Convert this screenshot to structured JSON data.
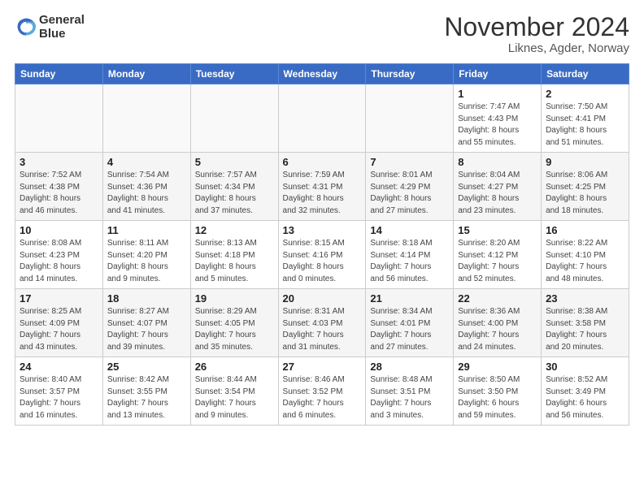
{
  "header": {
    "logo_line1": "General",
    "logo_line2": "Blue",
    "month": "November 2024",
    "location": "Liknes, Agder, Norway"
  },
  "weekdays": [
    "Sunday",
    "Monday",
    "Tuesday",
    "Wednesday",
    "Thursday",
    "Friday",
    "Saturday"
  ],
  "weeks": [
    [
      {
        "day": "",
        "info": ""
      },
      {
        "day": "",
        "info": ""
      },
      {
        "day": "",
        "info": ""
      },
      {
        "day": "",
        "info": ""
      },
      {
        "day": "",
        "info": ""
      },
      {
        "day": "1",
        "info": "Sunrise: 7:47 AM\nSunset: 4:43 PM\nDaylight: 8 hours\nand 55 minutes."
      },
      {
        "day": "2",
        "info": "Sunrise: 7:50 AM\nSunset: 4:41 PM\nDaylight: 8 hours\nand 51 minutes."
      }
    ],
    [
      {
        "day": "3",
        "info": "Sunrise: 7:52 AM\nSunset: 4:38 PM\nDaylight: 8 hours\nand 46 minutes."
      },
      {
        "day": "4",
        "info": "Sunrise: 7:54 AM\nSunset: 4:36 PM\nDaylight: 8 hours\nand 41 minutes."
      },
      {
        "day": "5",
        "info": "Sunrise: 7:57 AM\nSunset: 4:34 PM\nDaylight: 8 hours\nand 37 minutes."
      },
      {
        "day": "6",
        "info": "Sunrise: 7:59 AM\nSunset: 4:31 PM\nDaylight: 8 hours\nand 32 minutes."
      },
      {
        "day": "7",
        "info": "Sunrise: 8:01 AM\nSunset: 4:29 PM\nDaylight: 8 hours\nand 27 minutes."
      },
      {
        "day": "8",
        "info": "Sunrise: 8:04 AM\nSunset: 4:27 PM\nDaylight: 8 hours\nand 23 minutes."
      },
      {
        "day": "9",
        "info": "Sunrise: 8:06 AM\nSunset: 4:25 PM\nDaylight: 8 hours\nand 18 minutes."
      }
    ],
    [
      {
        "day": "10",
        "info": "Sunrise: 8:08 AM\nSunset: 4:23 PM\nDaylight: 8 hours\nand 14 minutes."
      },
      {
        "day": "11",
        "info": "Sunrise: 8:11 AM\nSunset: 4:20 PM\nDaylight: 8 hours\nand 9 minutes."
      },
      {
        "day": "12",
        "info": "Sunrise: 8:13 AM\nSunset: 4:18 PM\nDaylight: 8 hours\nand 5 minutes."
      },
      {
        "day": "13",
        "info": "Sunrise: 8:15 AM\nSunset: 4:16 PM\nDaylight: 8 hours\nand 0 minutes."
      },
      {
        "day": "14",
        "info": "Sunrise: 8:18 AM\nSunset: 4:14 PM\nDaylight: 7 hours\nand 56 minutes."
      },
      {
        "day": "15",
        "info": "Sunrise: 8:20 AM\nSunset: 4:12 PM\nDaylight: 7 hours\nand 52 minutes."
      },
      {
        "day": "16",
        "info": "Sunrise: 8:22 AM\nSunset: 4:10 PM\nDaylight: 7 hours\nand 48 minutes."
      }
    ],
    [
      {
        "day": "17",
        "info": "Sunrise: 8:25 AM\nSunset: 4:09 PM\nDaylight: 7 hours\nand 43 minutes."
      },
      {
        "day": "18",
        "info": "Sunrise: 8:27 AM\nSunset: 4:07 PM\nDaylight: 7 hours\nand 39 minutes."
      },
      {
        "day": "19",
        "info": "Sunrise: 8:29 AM\nSunset: 4:05 PM\nDaylight: 7 hours\nand 35 minutes."
      },
      {
        "day": "20",
        "info": "Sunrise: 8:31 AM\nSunset: 4:03 PM\nDaylight: 7 hours\nand 31 minutes."
      },
      {
        "day": "21",
        "info": "Sunrise: 8:34 AM\nSunset: 4:01 PM\nDaylight: 7 hours\nand 27 minutes."
      },
      {
        "day": "22",
        "info": "Sunrise: 8:36 AM\nSunset: 4:00 PM\nDaylight: 7 hours\nand 24 minutes."
      },
      {
        "day": "23",
        "info": "Sunrise: 8:38 AM\nSunset: 3:58 PM\nDaylight: 7 hours\nand 20 minutes."
      }
    ],
    [
      {
        "day": "24",
        "info": "Sunrise: 8:40 AM\nSunset: 3:57 PM\nDaylight: 7 hours\nand 16 minutes."
      },
      {
        "day": "25",
        "info": "Sunrise: 8:42 AM\nSunset: 3:55 PM\nDaylight: 7 hours\nand 13 minutes."
      },
      {
        "day": "26",
        "info": "Sunrise: 8:44 AM\nSunset: 3:54 PM\nDaylight: 7 hours\nand 9 minutes."
      },
      {
        "day": "27",
        "info": "Sunrise: 8:46 AM\nSunset: 3:52 PM\nDaylight: 7 hours\nand 6 minutes."
      },
      {
        "day": "28",
        "info": "Sunrise: 8:48 AM\nSunset: 3:51 PM\nDaylight: 7 hours\nand 3 minutes."
      },
      {
        "day": "29",
        "info": "Sunrise: 8:50 AM\nSunset: 3:50 PM\nDaylight: 6 hours\nand 59 minutes."
      },
      {
        "day": "30",
        "info": "Sunrise: 8:52 AM\nSunset: 3:49 PM\nDaylight: 6 hours\nand 56 minutes."
      }
    ]
  ]
}
